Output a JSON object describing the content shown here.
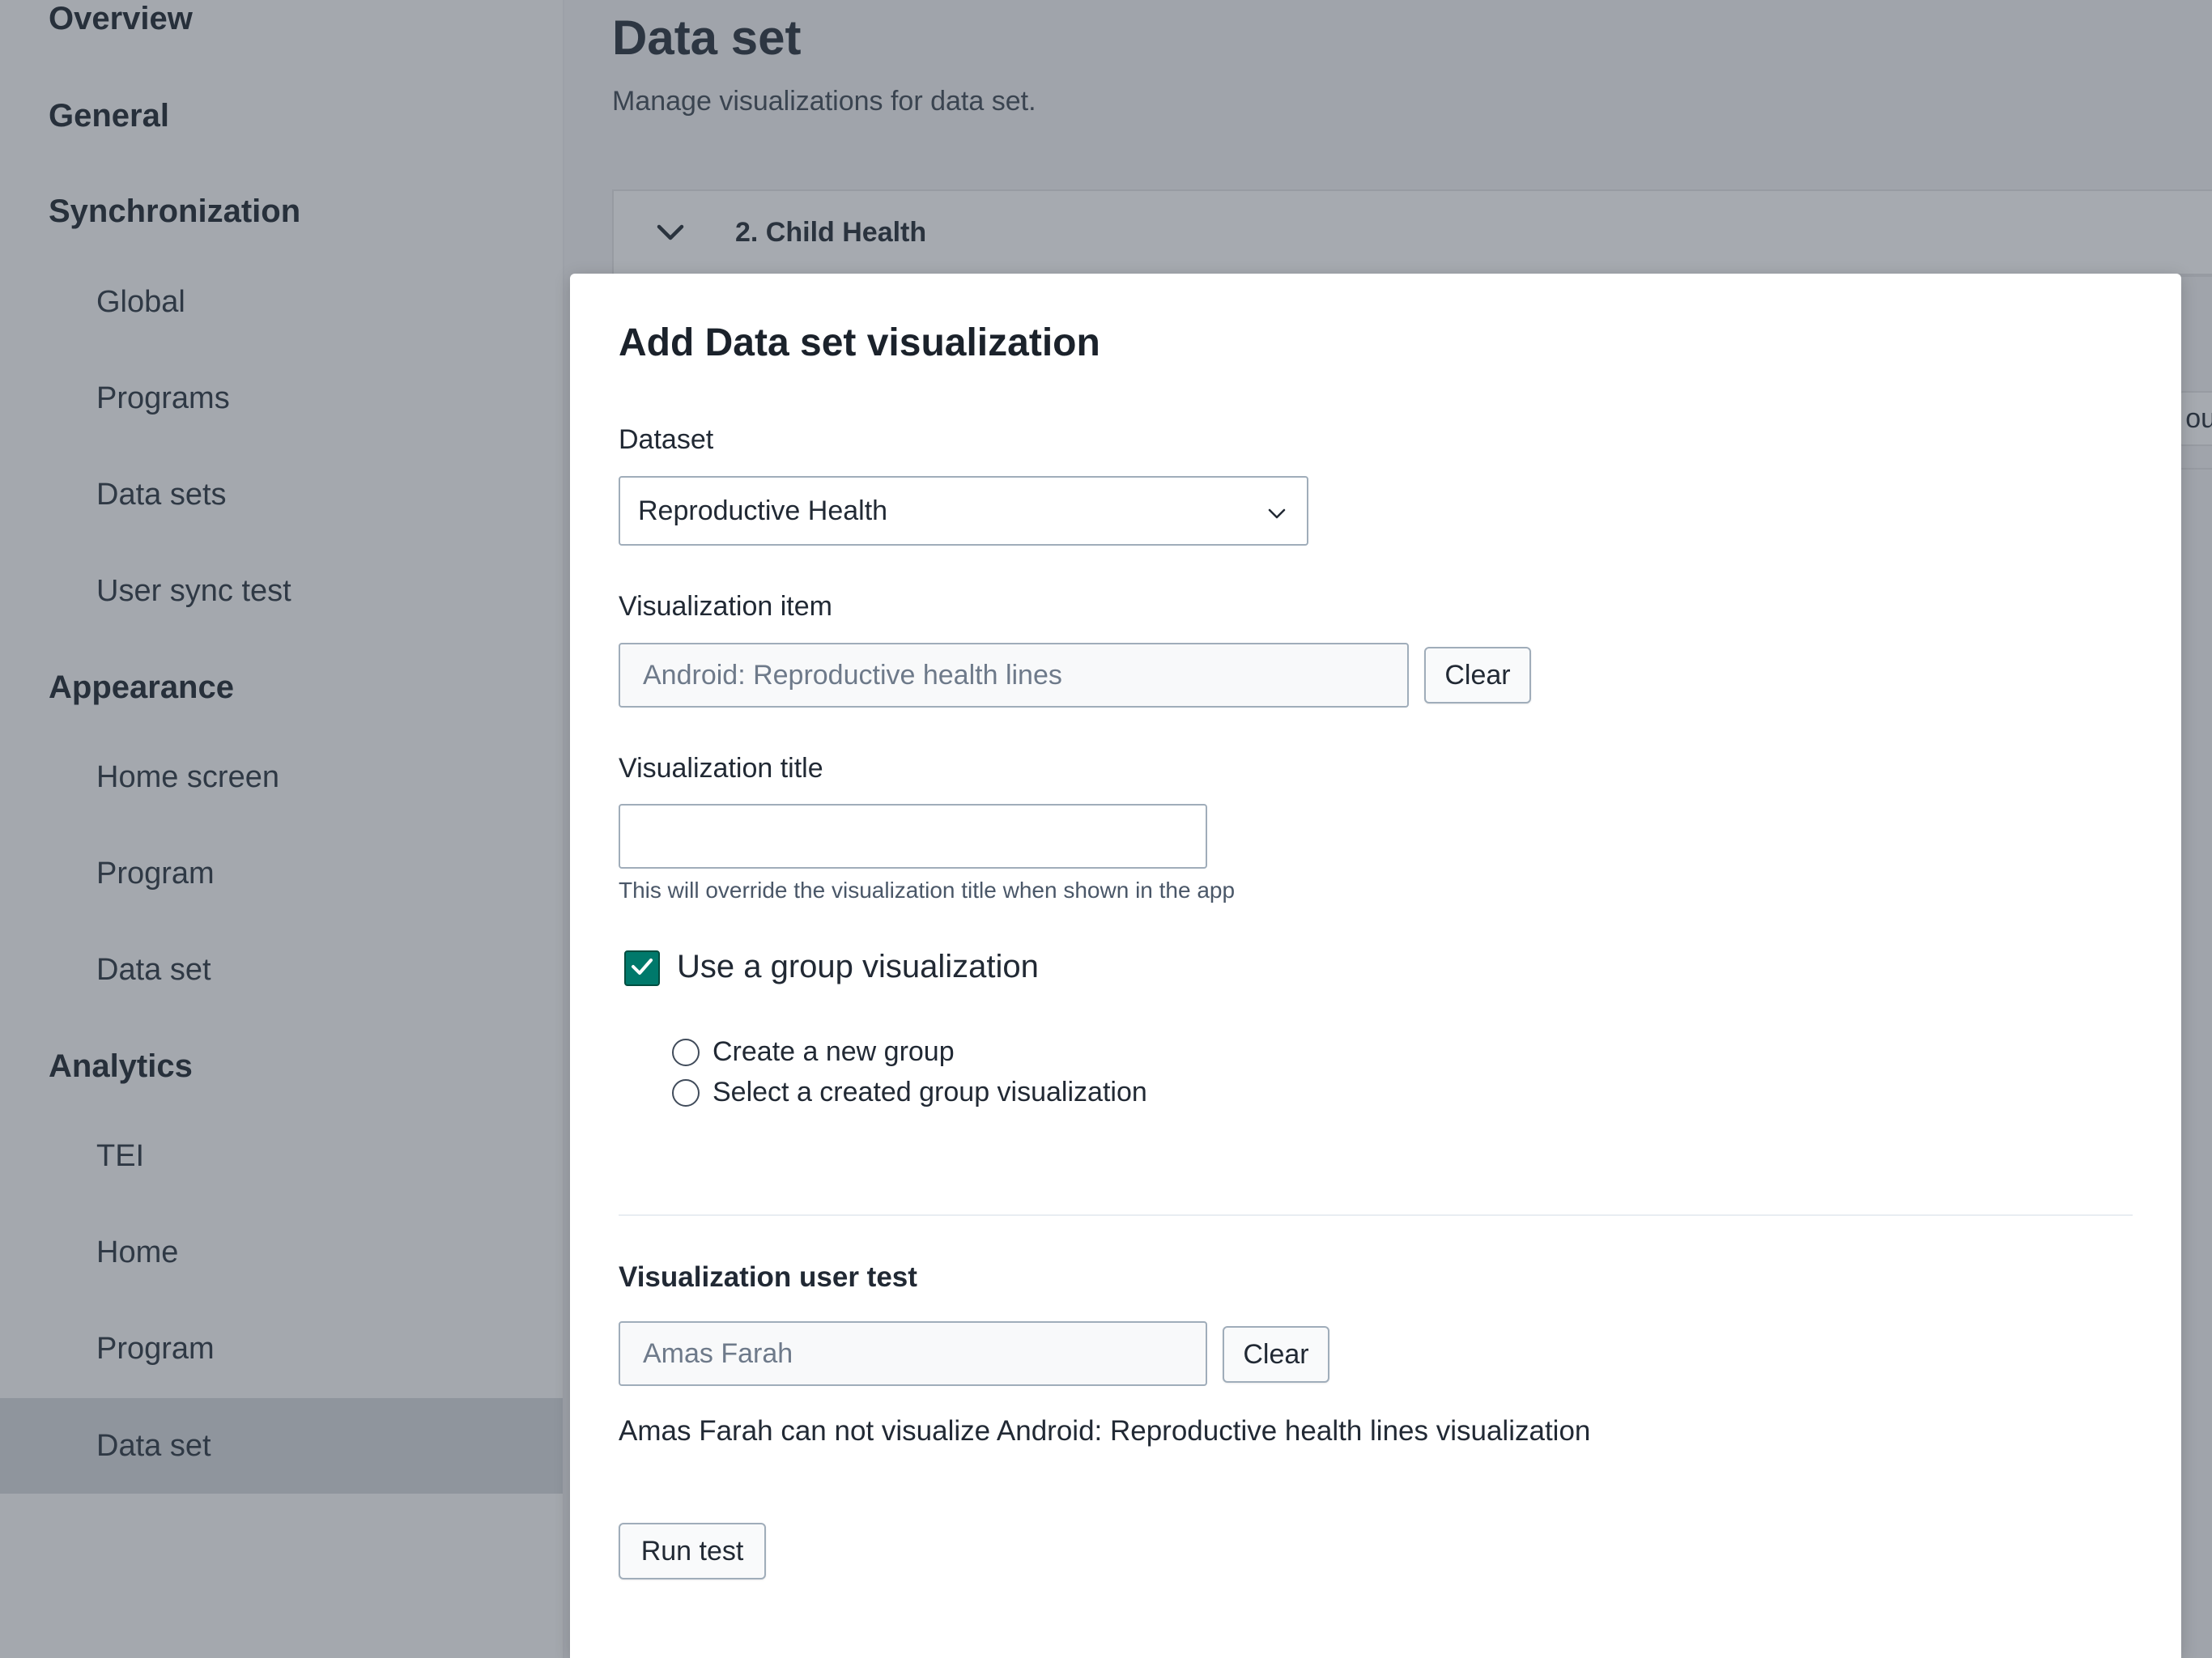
{
  "sidebar": {
    "items": [
      {
        "label": "Overview",
        "type": "section"
      },
      {
        "label": "General",
        "type": "section"
      },
      {
        "label": "Synchronization",
        "type": "section"
      },
      {
        "label": "Global",
        "type": "child"
      },
      {
        "label": "Programs",
        "type": "child"
      },
      {
        "label": "Data sets",
        "type": "child"
      },
      {
        "label": "User sync test",
        "type": "child"
      },
      {
        "label": "Appearance",
        "type": "section"
      },
      {
        "label": "Home screen",
        "type": "child"
      },
      {
        "label": "Program",
        "type": "child"
      },
      {
        "label": "Data set",
        "type": "child"
      },
      {
        "label": "Analytics",
        "type": "section"
      },
      {
        "label": "TEI",
        "type": "child"
      },
      {
        "label": "Home",
        "type": "child"
      },
      {
        "label": "Program",
        "type": "child"
      },
      {
        "label": "Data set",
        "type": "child",
        "active": true
      }
    ]
  },
  "page": {
    "title": "Data set",
    "subtitle": "Manage visualizations for data set.",
    "accordion_label": "2. Child Health",
    "edge_fragment": "oup"
  },
  "modal": {
    "title": "Add Data set visualization",
    "dataset": {
      "label": "Dataset",
      "value": "Reproductive Health"
    },
    "visualization_item": {
      "label": "Visualization item",
      "value": "Android: Reproductive health lines",
      "clear_label": "Clear"
    },
    "visualization_title": {
      "label": "Visualization title",
      "value": "",
      "help": "This will override the visualization title when shown in the app"
    },
    "group": {
      "checkbox_label": "Use a group visualization",
      "checked": true,
      "options": [
        "Create a new group",
        "Select a created group visualization"
      ]
    },
    "user_test": {
      "label": "Visualization user test",
      "value": "Amas Farah",
      "clear_label": "Clear",
      "result": "Amas Farah can not visualize Android: Reproductive health lines visualization",
      "run_label": "Run test"
    }
  },
  "colors": {
    "accent": "#00796b",
    "overlay": "#a0a4ab",
    "active_nav": "#8f959d"
  }
}
